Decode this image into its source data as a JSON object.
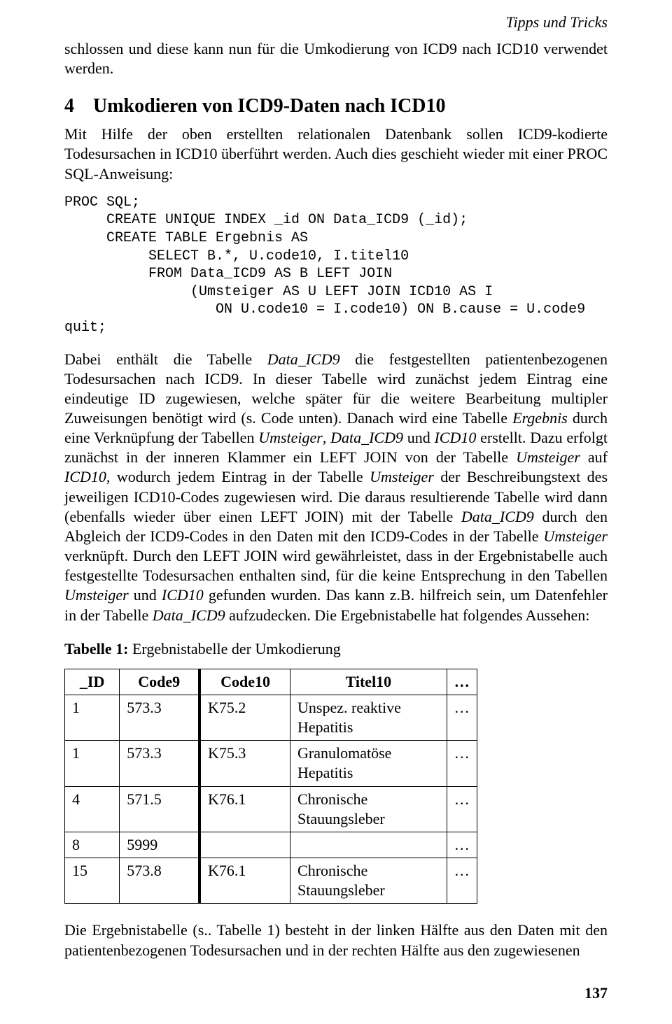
{
  "header": {
    "right": "Tipps und Tricks"
  },
  "intro_para": "schlossen und diese kann nun für die Umkodierung von ICD9 nach ICD10 verwendet werden.",
  "section": {
    "number": "4",
    "title": "Umkodieren von ICD9-Daten nach ICD10",
    "lead": "Mit Hilfe der oben erstellten relationalen Datenbank sollen ICD9-kodierte Todesursachen in ICD10 überführt werden. Auch dies geschieht wieder mit einer PROC SQL-Anweisung:"
  },
  "code": "PROC SQL;\n     CREATE UNIQUE INDEX _id ON Data_ICD9 (_id);\n     CREATE TABLE Ergebnis AS\n          SELECT B.*, U.code10, I.titel10\n          FROM Data_ICD9 AS B LEFT JOIN\n               (Umsteiger AS U LEFT JOIN ICD10 AS I\n                  ON U.code10 = I.code10) ON B.cause = U.code9\nquit;",
  "body_html": "Dabei enthält die Tabelle <span class=\"italic\">Data_ICD9</span> die festgestellten patientenbezogenen Todesursachen nach ICD9. In dieser Tabelle wird zunächst jedem Eintrag eine eindeutige ID zugewiesen, welche später für die weitere Bearbeitung multipler Zuweisungen benötigt wird (s. Code unten). Danach wird eine Tabelle <span class=\"italic\">Ergebnis</span> durch eine Verknüpfung der Tabellen <span class=\"italic\">Umsteiger</span>, <span class=\"italic\">Data_ICD9</span> und <span class=\"italic\">ICD10</span> erstellt. Dazu erfolgt zunächst in der inneren Klammer ein LEFT JOIN von der Tabelle <span class=\"italic\">Umsteiger</span> auf <span class=\"italic\">ICD10</span>, wodurch jedem Eintrag in der Tabelle <span class=\"italic\">Umsteiger</span> der Beschreibungstext des jeweiligen ICD10-Codes zugewiesen wird. Die daraus resultierende Tabelle wird dann (ebenfalls wieder über einen LEFT JOIN) mit der Tabelle <span class=\"italic\">Data_ICD9</span> durch den Abgleich der ICD9-Codes in den Daten mit den ICD9-Codes in der Tabelle <span class=\"italic\">Umsteiger</span> verknüpft. Durch den LEFT JOIN wird gewährleistet, dass in der Ergebnistabelle auch festgestellte Todesursachen enthalten sind, für die keine Entsprechung in den Tabellen <span class=\"italic\">Umsteiger</span> und <span class=\"italic\">ICD10</span> gefunden wurden. Das kann z.B. hilfreich sein, um Datenfehler in der Tabelle <span class=\"italic\">Data_ICD9</span> aufzudecken. Die Ergebnistabelle hat folgendes Aussehen:",
  "table": {
    "caption_prefix": "Tabelle 1:",
    "caption_text": " Ergebnistabelle der Umkodierung",
    "headers": [
      "_ID",
      "Code9",
      "Code10",
      "Titel10",
      "…"
    ],
    "rows": [
      [
        "1",
        "573.3",
        "K75.2",
        "Unspez. reaktive Hepatitis",
        "…"
      ],
      [
        "1",
        "573.3",
        "K75.3",
        "Granulomatöse Hepatitis",
        "…"
      ],
      [
        "4",
        "571.5",
        "K76.1",
        "Chronische Stauungsleber",
        "…"
      ],
      [
        "8",
        "5999",
        "",
        "",
        "…"
      ],
      [
        "15",
        "573.8",
        "K76.1",
        "Chronische Stauungsleber",
        "…"
      ]
    ]
  },
  "closing_para": "Die Ergebnistabelle (s.. Tabelle 1) besteht in der linken Hälfte aus den Daten mit den patientenbezogenen Todesursachen und in der rechten Hälfte aus den zugewiesenen",
  "page_number": "137"
}
